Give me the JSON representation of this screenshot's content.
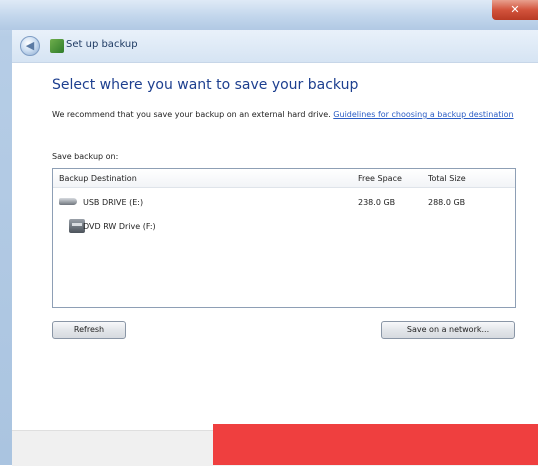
{
  "window": {
    "title": "Set up backup",
    "close_glyph": "✕",
    "back_glyph": "◀"
  },
  "main": {
    "heading": "Select where you want to save your backup",
    "recommend_text": "We recommend that you save your backup on an external hard drive.",
    "guidelines_link": "Guidelines for choosing a backup destination",
    "save_label": "Save backup on:"
  },
  "list": {
    "columns": {
      "destination": "Backup Destination",
      "free_space": "Free Space",
      "total_size": "Total Size"
    },
    "rows": [
      {
        "name": "USB DRIVE (E:)",
        "free": "238.0 GB",
        "total": "288.0 GB",
        "icon": "usb-drive-icon"
      },
      {
        "name": "DVD RW Drive (F:)",
        "free": "",
        "total": "",
        "icon": "dvd-drive-icon"
      }
    ]
  },
  "buttons": {
    "refresh": "Refresh",
    "save_network": "Save on a network..."
  },
  "colors": {
    "heading": "#1d3f8f",
    "link": "#2a5cc4",
    "overlay": "#ef3f3f"
  }
}
